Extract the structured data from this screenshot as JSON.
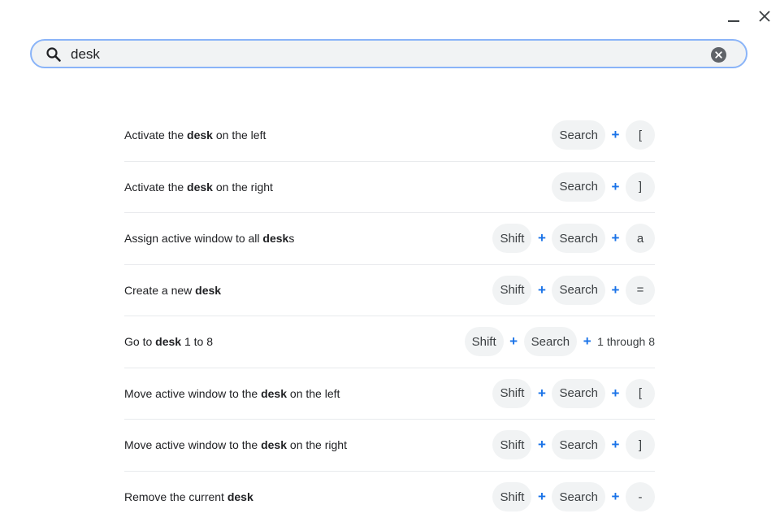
{
  "window": {
    "minimize_icon": "minimize-icon",
    "close_icon": "close-icon"
  },
  "search": {
    "value": "desk",
    "placeholder": "",
    "icon": "search-icon",
    "clear_icon": "clear-circle-icon"
  },
  "colors": {
    "accent": "#1a73e8",
    "search_border": "#8ab4f8",
    "key_bg": "#f1f3f4",
    "divider": "#e8eaed"
  },
  "shortcuts": [
    {
      "before": "Activate the ",
      "match": "desk",
      "after": " on the left",
      "keys": [
        {
          "type": "key",
          "text": "Search"
        },
        {
          "type": "plus",
          "text": "+"
        },
        {
          "type": "key",
          "text": "["
        }
      ]
    },
    {
      "before": "Activate the ",
      "match": "desk",
      "after": " on the right",
      "keys": [
        {
          "type": "key",
          "text": "Search"
        },
        {
          "type": "plus",
          "text": "+"
        },
        {
          "type": "key",
          "text": "]"
        }
      ]
    },
    {
      "before": "Assign active window to all ",
      "match": "desk",
      "after": "s",
      "keys": [
        {
          "type": "key",
          "text": "Shift"
        },
        {
          "type": "plus",
          "text": "+"
        },
        {
          "type": "key",
          "text": "Search"
        },
        {
          "type": "plus",
          "text": "+"
        },
        {
          "type": "key",
          "text": "a"
        }
      ]
    },
    {
      "before": "Create a new ",
      "match": "desk",
      "after": "",
      "keys": [
        {
          "type": "key",
          "text": "Shift"
        },
        {
          "type": "plus",
          "text": "+"
        },
        {
          "type": "key",
          "text": "Search"
        },
        {
          "type": "plus",
          "text": "+"
        },
        {
          "type": "key",
          "text": "="
        }
      ]
    },
    {
      "before": "Go to ",
      "match": "desk",
      "after": " 1 to 8",
      "keys": [
        {
          "type": "key",
          "text": "Shift"
        },
        {
          "type": "plus",
          "text": "+"
        },
        {
          "type": "key",
          "text": "Search"
        },
        {
          "type": "plus",
          "text": "+"
        },
        {
          "type": "text",
          "text": "1 through 8"
        }
      ]
    },
    {
      "before": "Move active window to the ",
      "match": "desk",
      "after": " on the left",
      "keys": [
        {
          "type": "key",
          "text": "Shift"
        },
        {
          "type": "plus",
          "text": "+"
        },
        {
          "type": "key",
          "text": "Search"
        },
        {
          "type": "plus",
          "text": "+"
        },
        {
          "type": "key",
          "text": "["
        }
      ]
    },
    {
      "before": "Move active window to the ",
      "match": "desk",
      "after": " on the right",
      "keys": [
        {
          "type": "key",
          "text": "Shift"
        },
        {
          "type": "plus",
          "text": "+"
        },
        {
          "type": "key",
          "text": "Search"
        },
        {
          "type": "plus",
          "text": "+"
        },
        {
          "type": "key",
          "text": "]"
        }
      ]
    },
    {
      "before": "Remove the current ",
      "match": "desk",
      "after": "",
      "keys": [
        {
          "type": "key",
          "text": "Shift"
        },
        {
          "type": "plus",
          "text": "+"
        },
        {
          "type": "key",
          "text": "Search"
        },
        {
          "type": "plus",
          "text": "+"
        },
        {
          "type": "key",
          "text": "-"
        }
      ]
    }
  ]
}
